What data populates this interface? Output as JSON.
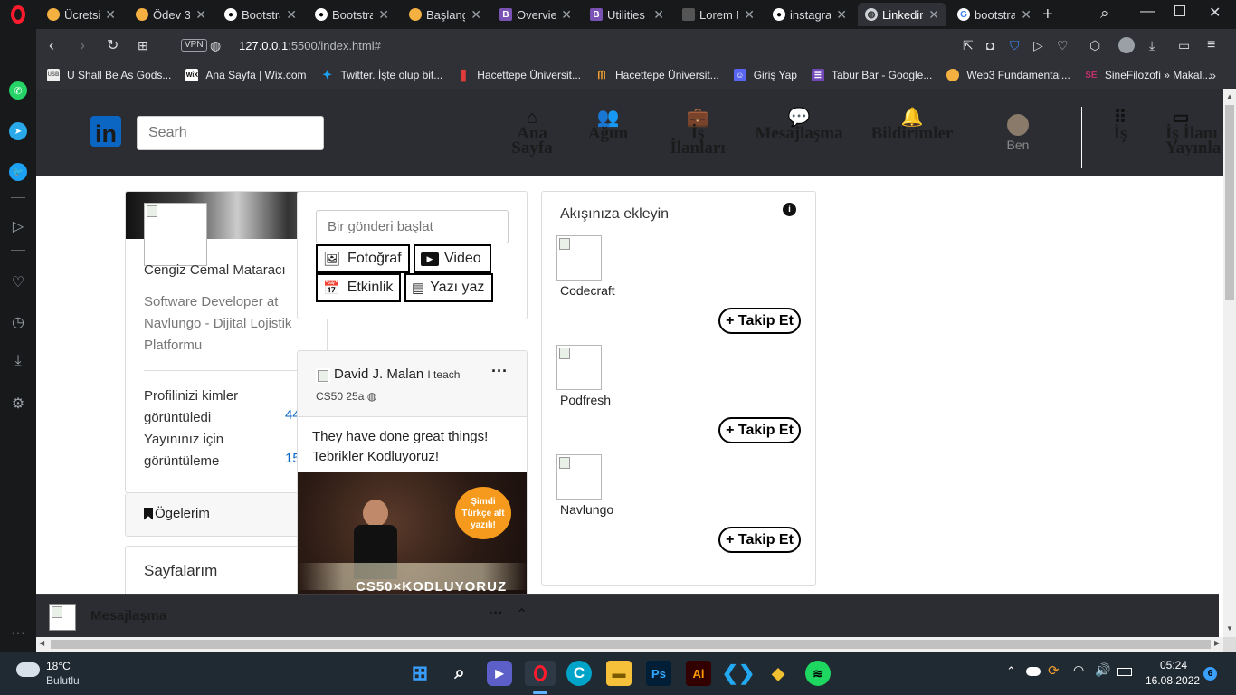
{
  "tabs": [
    {
      "label": "Ücretsiz",
      "icon": "orange-circle-icon"
    },
    {
      "label": "Ödev 3",
      "icon": "orange-circle-icon"
    },
    {
      "label": "Bootstrap",
      "icon": "github-icon"
    },
    {
      "label": "Bootstrap",
      "icon": "github-icon"
    },
    {
      "label": "Başlangıç",
      "icon": "orange-circle-icon"
    },
    {
      "label": "Overview",
      "icon": "bootstrap-icon"
    },
    {
      "label": "Utilities f",
      "icon": "bootstrap-icon"
    },
    {
      "label": "Lorem Pi",
      "icon": "image-icon"
    },
    {
      "label": "instagram",
      "icon": "github-icon"
    },
    {
      "label": "Linkedin",
      "icon": "globe-icon"
    },
    {
      "label": "bootstrap",
      "icon": "google-icon"
    }
  ],
  "address": {
    "url_host": "127.0.0.1",
    "url_rest": ":5500/index.html#",
    "vpn_label": "VPN"
  },
  "bookmarks": [
    {
      "label": "U Shall Be As Gods...",
      "icon": "USB"
    },
    {
      "label": "Ana Sayfa | Wix.com",
      "icon": "WiX"
    },
    {
      "label": "Twitter. İşte olup bit...",
      "icon": "twitter-icon"
    },
    {
      "label": "Hacettepe Üniversit...",
      "icon": "hacettepe-icon"
    },
    {
      "label": "Hacettepe Üniversit...",
      "icon": "hacettepe-icon"
    },
    {
      "label": "Giriş Yap",
      "icon": "discord-icon"
    },
    {
      "label": "Tabur Bar - Google...",
      "icon": "tabur-icon"
    },
    {
      "label": "Web3 Fundamental...",
      "icon": "web3-icon"
    },
    {
      "label": "SineFilozofi » Makal...",
      "icon": "sine-icon"
    }
  ],
  "nav": {
    "search_placeholder": "Searh",
    "items": [
      {
        "label": "Ana Sayfa"
      },
      {
        "label": "Ağım"
      },
      {
        "label": "İş İlanları"
      },
      {
        "label": "Mesajlaşma"
      },
      {
        "label": "Bildirimler"
      },
      {
        "label": "Ben"
      },
      {
        "label": "İş"
      },
      {
        "label": "İş İlanı Yayınla"
      }
    ],
    "brand": "in"
  },
  "profile": {
    "name": "Cengiz Cemal Mataracı",
    "headline": "Software Developer at Navlungo - Dijital Lojistik Platformu",
    "stat1_label": "Profilinizi kimler görüntüledi",
    "stat1_value": "44",
    "stat2_label": "Yayınınız için görüntüleme",
    "stat2_value": "15",
    "items_label": "Ögelerim",
    "pages_label": "Sayfalarım"
  },
  "composer": {
    "placeholder": "Bir gönderi başlat",
    "photo": "Fotoğraf",
    "video": "Video",
    "event": "Etkinlik",
    "article": "Yazı yaz"
  },
  "post": {
    "author": "David J. Malan",
    "author_sub": "I teach",
    "meta": "CS50 25a",
    "text_line1": "They have done great things!",
    "text_line2": "Tebrikler Kodluyoruz!",
    "badge": "Şimdi Türkçe alt yazılı!",
    "banner": "CS50×KODLUYORUZ"
  },
  "feed": {
    "title": "Akışınıza ekleyin",
    "follow_label": "+ Takip Et",
    "companies": [
      "Codecraft",
      "Podfresh",
      "Navlungo"
    ]
  },
  "messaging": {
    "label": "Mesajlaşma"
  },
  "taskbar": {
    "weather_temp": "18°C",
    "weather_text": "Bulutlu",
    "time": "05:24",
    "date": "16.08.2022",
    "notif_count": "6"
  },
  "colors": {
    "brand": "#0a66c2",
    "nav_bg": "#2b2d33",
    "opera_red": "#ff1b2d"
  }
}
